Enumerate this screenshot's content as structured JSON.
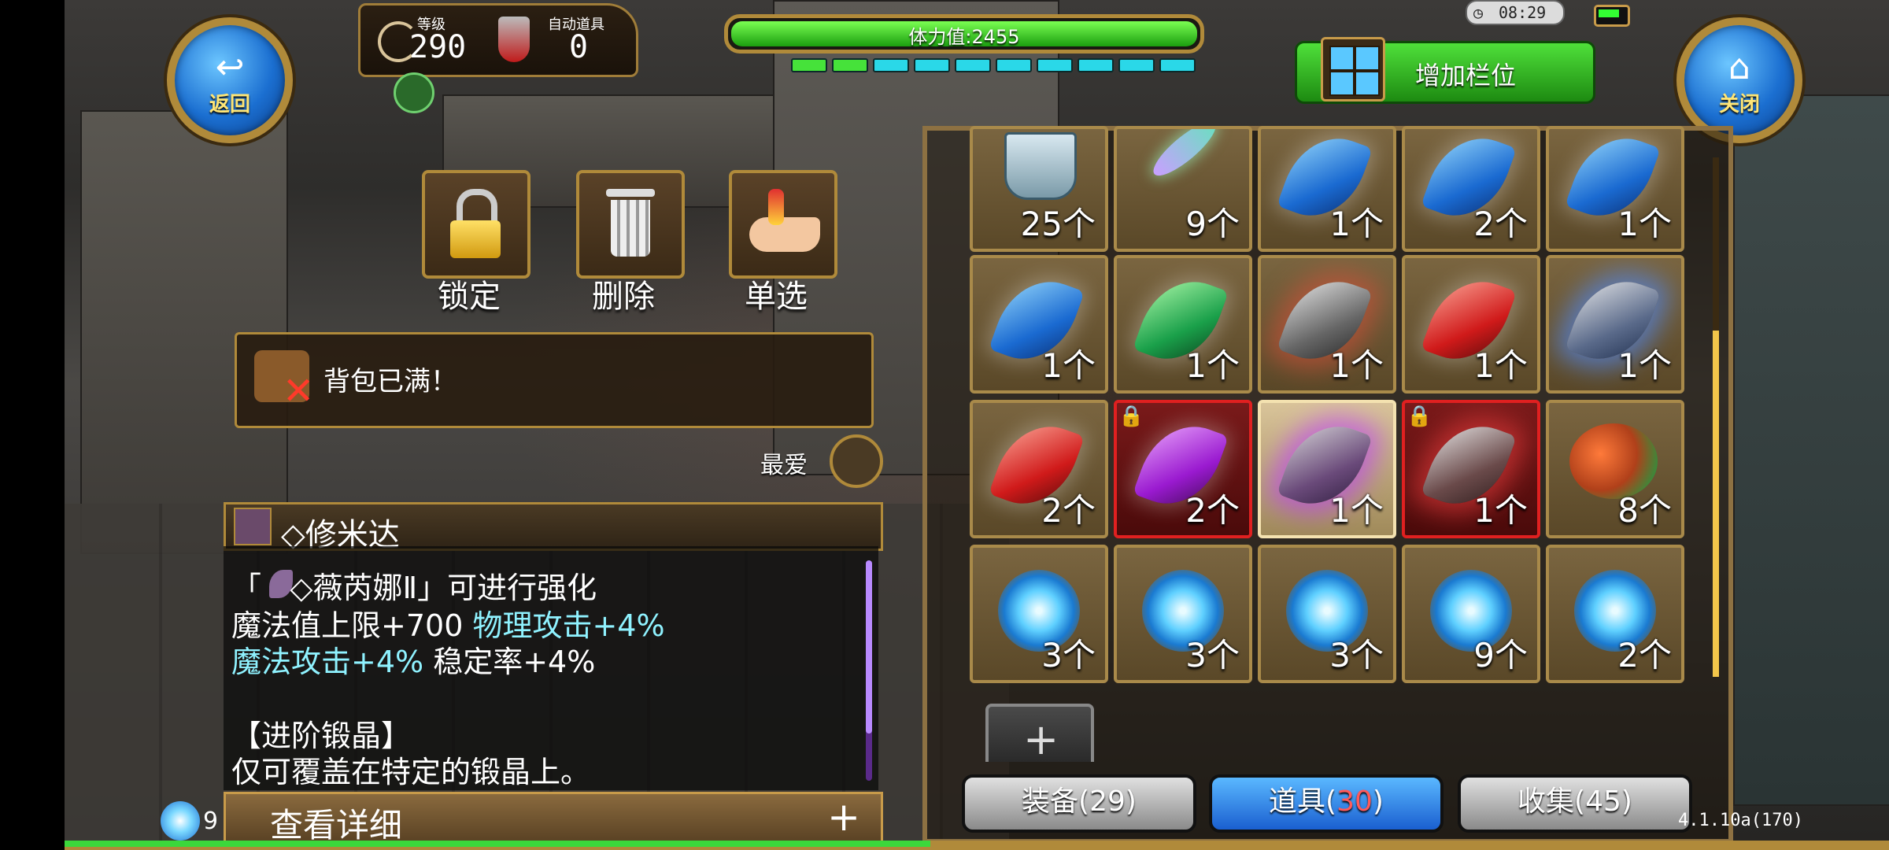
{
  "header": {
    "back_label": "返回",
    "close_label": "关闭",
    "level_label": "等级",
    "level_value": "290",
    "auto_item_label": "自动道具",
    "auto_item_value": "0",
    "stamina_text": "体力值:2455",
    "clock": "08:29",
    "add_slot_label": "增加栏位"
  },
  "actions": {
    "lock_label": "锁定",
    "delete_label": "删除",
    "single_select_label": "单选"
  },
  "message": "背包已满！",
  "favorite_label": "最爱",
  "item": {
    "title": "◇修米达",
    "line1": "「   ◇薇芮娜Ⅱ」可进行强化",
    "line2a": "魔法值上限+700 ",
    "line2b": "物理攻击+4%",
    "line3a": "魔法攻击+4%",
    "line3b": " 稳定率+4%",
    "line4": "【进阶锻晶】",
    "line5": "仅可覆盖在特定的锻晶上。",
    "detail_label": "查看详细",
    "detail_plus": "+",
    "orb_prefix": "9"
  },
  "grid": {
    "rows": [
      [
        {
          "icon": "bucket-icon",
          "count": "25个",
          "style": "normal"
        },
        {
          "icon": "sword-icon",
          "count": "9个",
          "style": "normal"
        },
        {
          "icon": "blue-crystal-icon",
          "count": "1个",
          "style": "normal"
        },
        {
          "icon": "blue-crystal-icon",
          "count": "2个",
          "style": "normal"
        },
        {
          "icon": "blue-crystal-icon",
          "count": "1个",
          "style": "normal"
        }
      ],
      [
        {
          "icon": "blue-crystal-icon",
          "count": "1个",
          "style": "normal"
        },
        {
          "icon": "green-crystal-icon",
          "count": "1个",
          "style": "normal"
        },
        {
          "icon": "gray-crystal-icon",
          "count": "1个",
          "style": "normal"
        },
        {
          "icon": "red-crystal-icon",
          "count": "1个",
          "style": "normal"
        },
        {
          "icon": "gray-blue-crystal-icon",
          "count": "1个",
          "style": "normal"
        }
      ],
      [
        {
          "icon": "red-crystal-icon",
          "count": "2个",
          "style": "normal"
        },
        {
          "icon": "purple-crystal-icon",
          "count": "2个",
          "style": "red",
          "locked": true
        },
        {
          "icon": "gray-purple-crystal-icon",
          "count": "1个",
          "style": "sel"
        },
        {
          "icon": "gray-red-crystal-icon",
          "count": "1个",
          "style": "red",
          "locked": true
        },
        {
          "icon": "food-icon",
          "count": "8个",
          "style": "normal"
        }
      ],
      [
        {
          "icon": "blue-jewel-icon",
          "count": "3个",
          "style": "normal"
        },
        {
          "icon": "blue-jewel-icon",
          "count": "3个",
          "style": "normal"
        },
        {
          "icon": "blue-jewel-icon",
          "count": "3个",
          "style": "normal"
        },
        {
          "icon": "blue-jewel-icon",
          "count": "9个",
          "style": "normal"
        },
        {
          "icon": "blue-jewel-icon",
          "count": "2个",
          "style": "normal"
        }
      ]
    ]
  },
  "tabs": {
    "equip": "装备(29)",
    "items_prefix": "道具(",
    "items_count": "30",
    "items_suffix": ")",
    "collect": "收集(45)"
  },
  "version": "4.1.10a(170)",
  "colors": {
    "gold": "#b08a3a",
    "hp_green": "#1a9e0f",
    "cyan_text": "#8ff2ff",
    "tab_blue": "#1a5fd0"
  }
}
